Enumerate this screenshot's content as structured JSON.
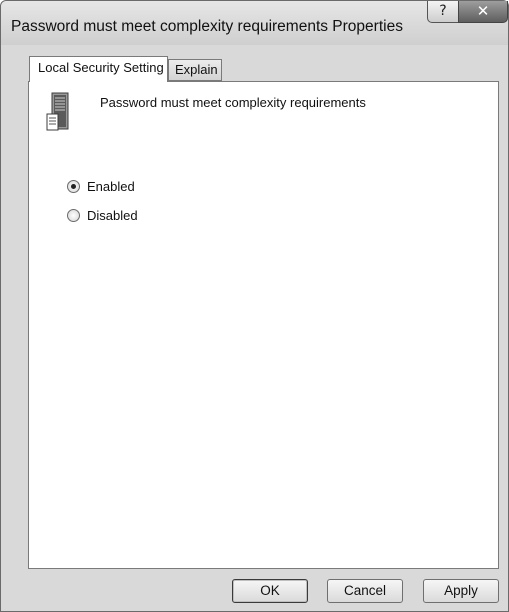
{
  "window": {
    "title": "Password must meet complexity requirements Properties",
    "help_glyph": "?",
    "close_glyph": "✕"
  },
  "tabs": [
    {
      "label": "Local Security Setting",
      "active": true
    },
    {
      "label": "Explain",
      "active": false
    }
  ],
  "policy": {
    "icon": "server-icon",
    "name": "Password must meet complexity requirements"
  },
  "options": [
    {
      "label": "Enabled",
      "selected": true
    },
    {
      "label": "Disabled",
      "selected": false
    }
  ],
  "buttons": {
    "ok": "OK",
    "cancel": "Cancel",
    "apply": "Apply"
  }
}
